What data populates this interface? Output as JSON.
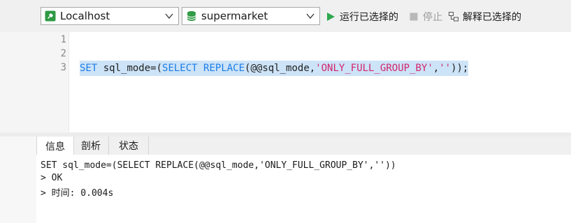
{
  "toolbar": {
    "connection": {
      "value": "Localhost",
      "icon": "connection-icon"
    },
    "database": {
      "value": "supermarket",
      "icon": "database-icon"
    },
    "run_selected": {
      "label": "运行已选择的",
      "icon": "play-icon"
    },
    "stop": {
      "label": "停止",
      "icon": "stop-icon"
    },
    "explain_selected": {
      "label": "解释已选择的",
      "icon": "explain-icon"
    }
  },
  "editor": {
    "line_numbers": [
      "1",
      "2",
      "3"
    ],
    "code": {
      "set_kw": "SET",
      "part1": " sql_mode=(",
      "select_kw": "SELECT",
      "part2": " ",
      "replace_kw": "REPLACE",
      "part3": "(@@sql_mode,",
      "str1": "'ONLY_FULL_GROUP_BY'",
      "part4": ",",
      "str2": "''",
      "part5": "));"
    }
  },
  "result_tabs": [
    "信息",
    "剖析",
    "状态"
  ],
  "result_tab_active": "信息",
  "messages": [
    "SET sql_mode=(SELECT REPLACE(@@sql_mode,'ONLY_FULL_GROUP_BY',''))",
    "> OK",
    "> 时间: 0.004s"
  ],
  "colors": {
    "keyword": "#1a7ee8",
    "string": "#d4246d",
    "selection": "#cde3f7",
    "run_green": "#2fa84f",
    "db_green": "#2e9a44"
  }
}
